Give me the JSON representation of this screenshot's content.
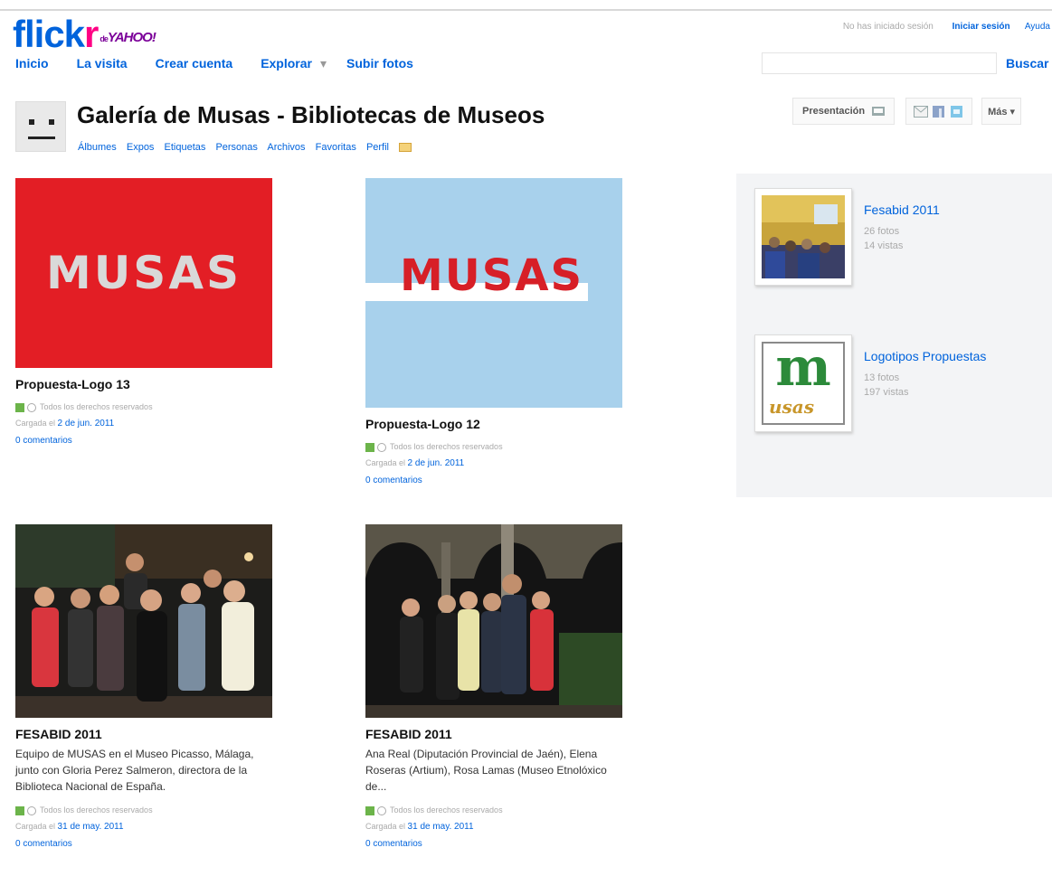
{
  "brand": {
    "flick": "flick",
    "r": "r",
    "de": "de",
    "yahoo": "YAHOO!"
  },
  "nav": {
    "items": [
      "Inicio",
      "La visita",
      "Crear cuenta",
      "Explorar",
      "Subir fotos"
    ],
    "explore_caret": "▾"
  },
  "account": {
    "status": "No has iniciado sesión",
    "login": "Iniciar sesión",
    "help": "Ayuda"
  },
  "search": {
    "value": "",
    "button": "Buscar"
  },
  "gallery": {
    "title": "Galería de Musas - Bibliotecas de Museos",
    "tabs": [
      "Álbumes",
      "Expos",
      "Etiquetas",
      "Personas",
      "Archivos",
      "Favoritas",
      "Perfil"
    ]
  },
  "toolbar": {
    "slideshow": "Presentación",
    "more": "Más ▾"
  },
  "photos": [
    {
      "image_text": "MUSAS",
      "title": "Propuesta-Logo 13",
      "license": "Todos los derechos reservados",
      "uploaded_prefix": "Cargada el",
      "uploaded_date": "2 de jun. 2011",
      "comments": "0 comentarios"
    },
    {
      "image_text": "MUSAS",
      "title": "Propuesta-Logo 12",
      "license": "Todos los derechos reservados",
      "uploaded_prefix": "Cargada el",
      "uploaded_date": "2 de jun. 2011",
      "comments": "0 comentarios"
    },
    {
      "title": "FESABID 2011",
      "description": "Equipo de MUSAS en el Museo Picasso, Málaga, junto con Gloria Perez Salmeron, directora de la Biblioteca Nacional de España.",
      "license": "Todos los derechos reservados",
      "uploaded_prefix": "Cargada el",
      "uploaded_date": "31 de may. 2011",
      "comments": "0 comentarios"
    },
    {
      "title": "FESABID 2011",
      "description": "Ana Real (Diputación Provincial de Jaén), Elena Roseras (Artium), Rosa Lamas (Museo Etnolóxico de...",
      "license": "Todos los derechos reservados",
      "uploaded_prefix": "Cargada el",
      "uploaded_date": "31 de may. 2011",
      "comments": "0 comentarios"
    }
  ],
  "sets": [
    {
      "title": "Fesabid 2011",
      "photos": "26 fotos",
      "views": "14 vistas"
    },
    {
      "title": "Logotipos Propuestas",
      "photos": "13 fotos",
      "views": "197 vistas",
      "logo_m": "m",
      "logo_text": "usas"
    }
  ],
  "colors": {
    "flickr_blue": "#0063dc",
    "flickr_pink": "#ff0084",
    "musas_red": "#e31e25",
    "musas_blue": "#a8d1ec",
    "logo_green": "#2c8a3a",
    "logo_gold": "#c8962a"
  }
}
